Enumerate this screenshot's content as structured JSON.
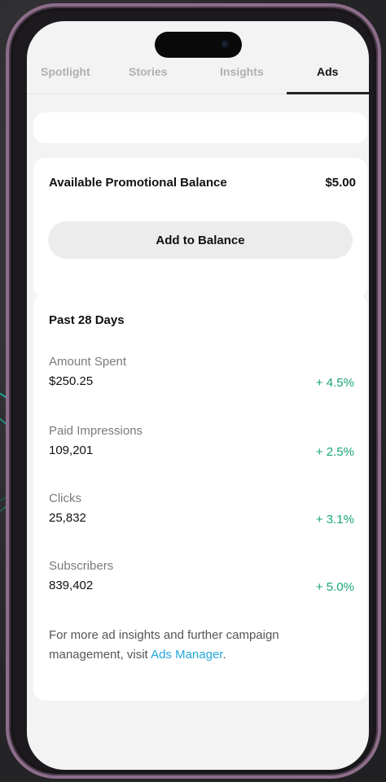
{
  "tabs": [
    {
      "label": "Spotlight"
    },
    {
      "label": "Stories"
    },
    {
      "label": "Insights"
    },
    {
      "label": "Ads"
    }
  ],
  "active_tab": "Ads",
  "balance": {
    "label": "Available Promotional Balance",
    "amount": "$5.00",
    "button_label": "Add to Balance"
  },
  "stats": {
    "period": "Past 28 Days",
    "metrics": [
      {
        "label": "Amount Spent",
        "value": "$250.25",
        "change": "+ 4.5%"
      },
      {
        "label": "Paid Impressions",
        "value": "109,201",
        "change": "+ 2.5%"
      },
      {
        "label": "Clicks",
        "value": "25,832",
        "change": "+ 3.1%"
      },
      {
        "label": "Subscribers",
        "value": "839,402",
        "change": "+ 5.0%"
      }
    ],
    "footer_text": "For more ad insights and further campaign management, visit ",
    "footer_link": "Ads Manager",
    "footer_end": "."
  },
  "colors": {
    "positive": "#18a57a",
    "link": "#25a6d9",
    "phone_frame": "#8c6d8a",
    "accent_arc": "#1fa896"
  }
}
